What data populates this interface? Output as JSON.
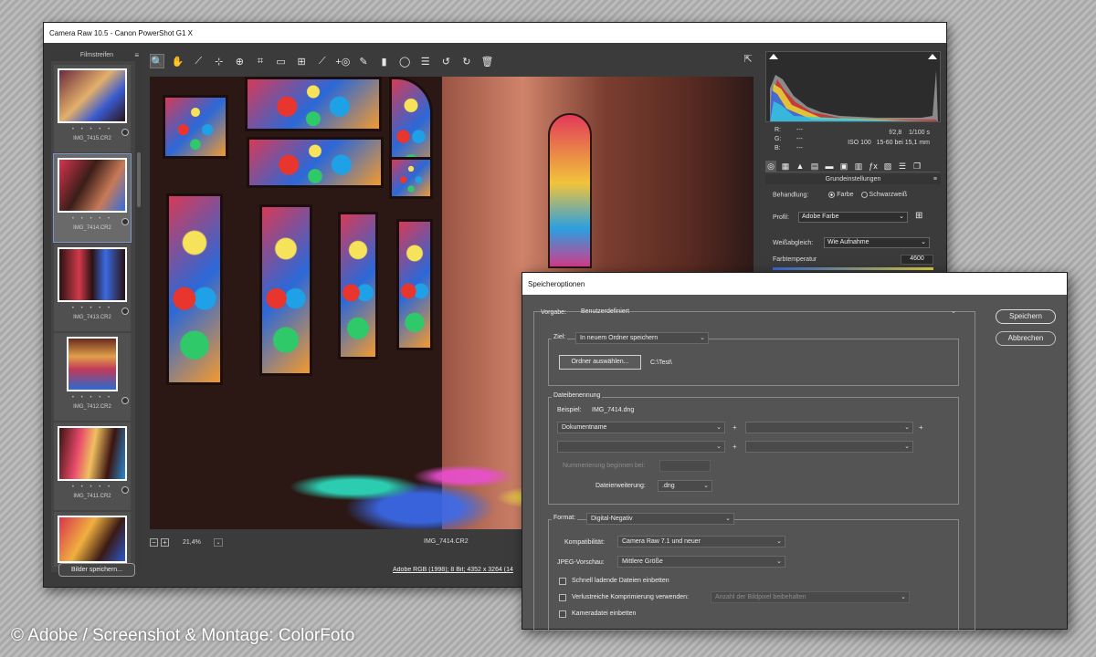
{
  "camera_raw": {
    "title": "Camera Raw 10.5  -  Canon PowerShot G1 X",
    "filmstrip": {
      "header": "Filmstreifen",
      "items": [
        {
          "label": "IMG_7415.CR2"
        },
        {
          "label": "IMG_7414.CR2"
        },
        {
          "label": "IMG_7413.CR2"
        },
        {
          "label": "IMG_7412.CR2"
        },
        {
          "label": "IMG_7411.CR2"
        }
      ],
      "stars": "• • • • •"
    },
    "toolbar": {
      "tools": [
        "zoom-icon",
        "hand-icon",
        "white-balance-icon",
        "color-sampler-icon",
        "target-adjust-icon",
        "crop-icon",
        "straighten-icon",
        "transform-icon",
        "spot-removal-icon",
        "red-eye-icon",
        "adjustment-brush-icon",
        "graduated-filter-icon",
        "radial-filter-icon",
        "preferences-icon",
        "rotate-left-icon",
        "rotate-right-icon",
        "trash-icon"
      ],
      "glyphs": [
        "🔍",
        "✋",
        "⟋",
        "⊹",
        "⊕",
        "⌗",
        "▭",
        "⊞",
        "⟋",
        "+◎",
        "✎",
        "▮",
        "◯",
        "☰",
        "↺",
        "↻",
        "🗑"
      ]
    },
    "preview": {
      "zoom": "21,4%",
      "filename": "IMG_7414.CR2"
    },
    "save_button": "Bilder speichern...",
    "workflow_link": "Adobe RGB (1998); 8 Bit; 4352 x 3264 (14",
    "right_panel": {
      "rgb": {
        "r_label": "R:",
        "g_label": "G:",
        "b_label": "B:",
        "r_val": "---",
        "g_val": "---",
        "b_val": "---"
      },
      "camera": {
        "aperture": "f/2,8",
        "shutter": "1/100 s",
        "iso": "ISO 100",
        "lens": "15-60 bei 15,1 mm"
      },
      "section_title": "Grundeinstellungen",
      "behandlung_label": "Behandlung:",
      "farbe": "Farbe",
      "schwarzweiss": "Schwarzweiß",
      "profil_label": "Profil:",
      "profil_value": "Adobe Farbe",
      "weissabgleich_label": "Weißabgleich:",
      "weissabgleich_value": "Wie Aufnahme",
      "farbtemperatur_label": "Farbtemperatur",
      "farbtemperatur_value": "4600"
    }
  },
  "save_dialog": {
    "title": "Speicheroptionen",
    "save_btn": "Speichern",
    "cancel_btn": "Abbrechen",
    "vorgabe_label": "Vorgabe:",
    "vorgabe_value": "Benutzerdefiniert",
    "ziel_label": "Ziel:",
    "ziel_value": "In neuem Ordner speichern",
    "folder_btn": "Ordner auswählen...",
    "folder_path": "C:\\Test\\",
    "dateibenennung_label": "Dateibenennung",
    "beispiel_label": "Beispiel:",
    "beispiel_value": "IMG_7414.dng",
    "naming_1": "Dokumentname",
    "nummerierung_label": "Nummerierung beginnen bei:",
    "erweiterung_label": "Dateierweiterung:",
    "erweiterung_value": ".dng",
    "format_label": "Format:",
    "format_value": "Digital-Negativ",
    "kompat_label": "Kompatibilität:",
    "kompat_value": "Camera Raw 7.1 und neuer",
    "jpeg_label": "JPEG-Vorschau:",
    "jpeg_value": "Mittlere Größe",
    "cb_schnell": "Schnell ladende Dateien einbetten",
    "cb_verlust": "Verlustreiche Komprimierung verwenden:",
    "verlust_value": "Anzahl der Bildpixel beibehalten",
    "cb_kamera": "Kameradatei einbetten"
  },
  "copyright": "© Adobe / Screenshot & Montage: ColorFoto"
}
